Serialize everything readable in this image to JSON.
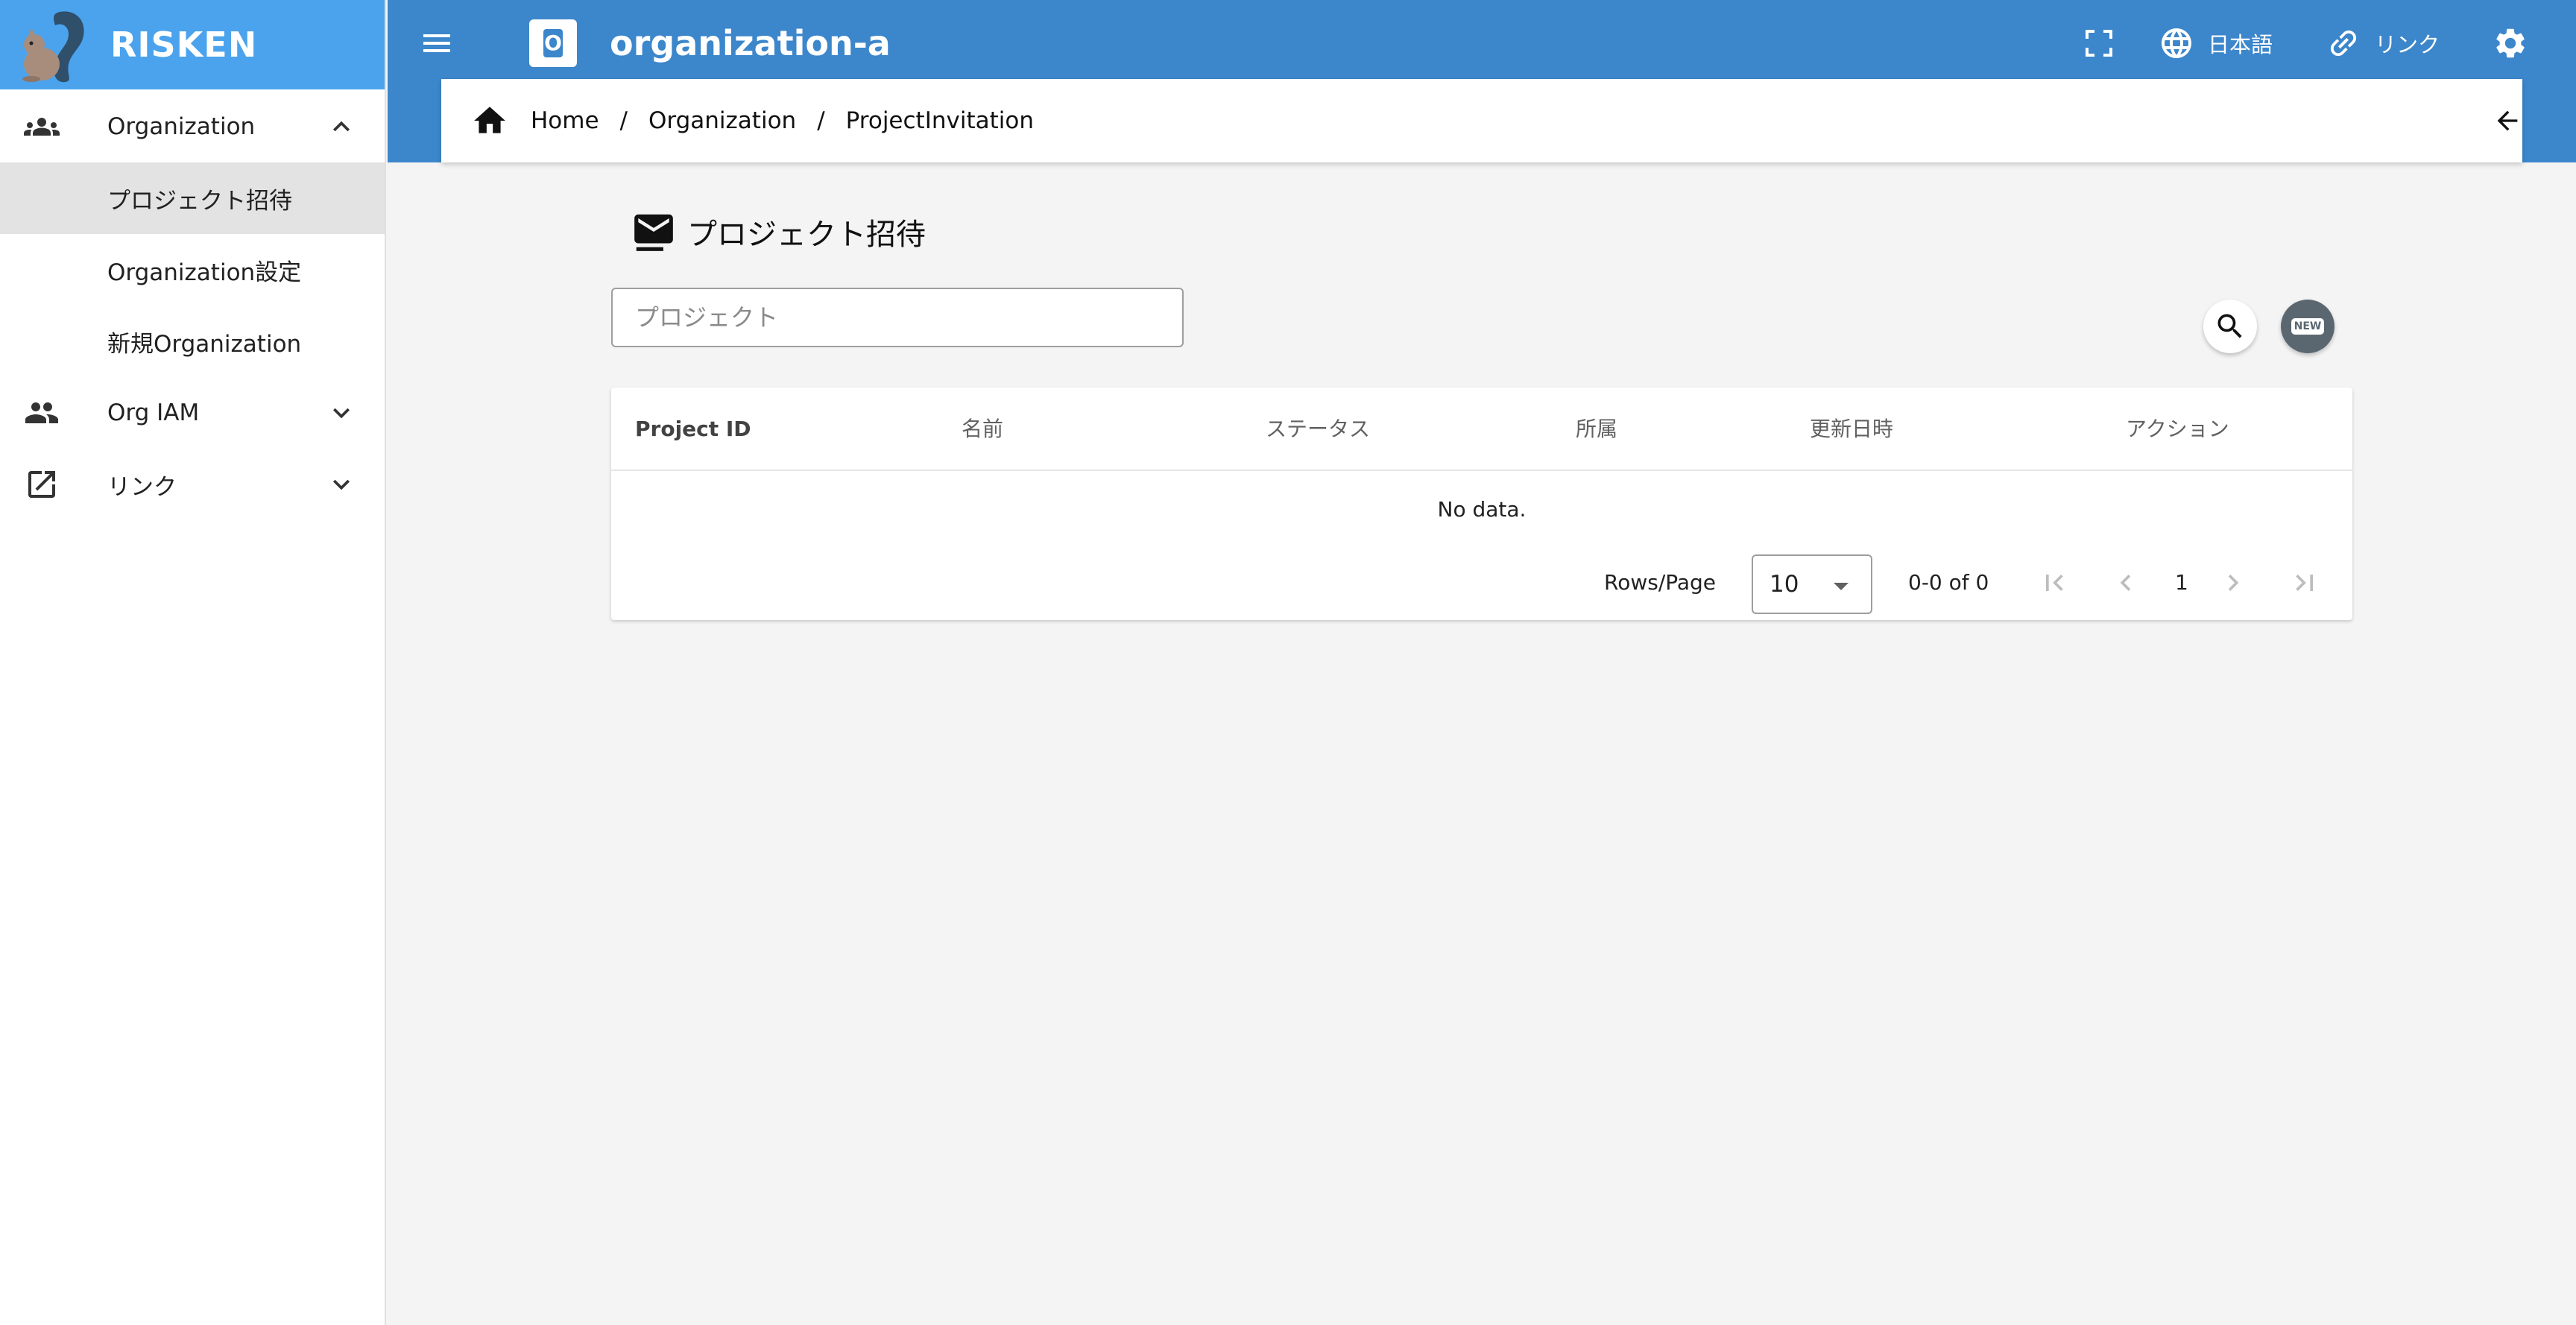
{
  "brand": {
    "name": "RISKEN"
  },
  "sidebar": {
    "groups": [
      {
        "label": "Organization",
        "expanded": true,
        "items": [
          {
            "label": "プロジェクト招待",
            "active": true
          },
          {
            "label": "Organization設定",
            "active": false
          },
          {
            "label": "新規Organization",
            "active": false
          }
        ]
      },
      {
        "label": "Org IAM",
        "expanded": false
      },
      {
        "label": "リンク",
        "expanded": false
      }
    ]
  },
  "appbar": {
    "org_badge": "O",
    "org_name": "organization-a",
    "language_label": "日本語",
    "link_label": "リンク"
  },
  "breadcrumb": [
    "Home",
    "Organization",
    "ProjectInvitation"
  ],
  "page": {
    "title": "プロジェクト招待",
    "search_placeholder": "プロジェクト",
    "new_badge": "NEW"
  },
  "table": {
    "columns": [
      "Project ID",
      "名前",
      "ステータス",
      "所属",
      "更新日時",
      "アクション"
    ],
    "rows": [],
    "empty_text": "No data.",
    "rows_per_page_label": "Rows/Page",
    "rows_per_page_value": "10",
    "range_text": "0-0 of 0",
    "current_page": "1"
  },
  "colors": {
    "brand_bar": "#4aa3ec",
    "app_bar": "#3c86cb",
    "sidebar_active": "#e3e3e3",
    "background": "#f4f4f4"
  }
}
